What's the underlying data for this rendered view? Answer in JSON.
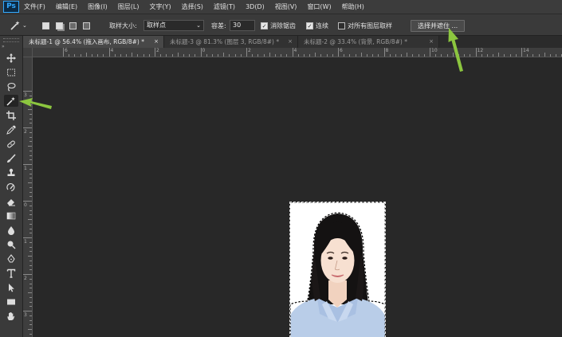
{
  "app": {
    "logo": "Ps"
  },
  "menu": [
    "文件(F)",
    "编辑(E)",
    "图像(I)",
    "图层(L)",
    "文字(Y)",
    "选择(S)",
    "滤镜(T)",
    "3D(D)",
    "视图(V)",
    "窗口(W)",
    "帮助(H)"
  ],
  "options": {
    "sample_size_label": "取样大小:",
    "sample_size_value": "取样点",
    "tolerance_label": "容差:",
    "tolerance_value": "30",
    "antialias_label": "消除锯齿",
    "antialias_checked": true,
    "contiguous_label": "连续",
    "contiguous_checked": true,
    "sample_all_label": "对所有图层取样",
    "sample_all_checked": false,
    "refine_button": "选择并遮住 ..."
  },
  "tabs": [
    {
      "label": "未标题-1 @ 56.4% (拖入画布, RGB/8#) *",
      "close": "×",
      "active": true
    },
    {
      "label": "未标题-3 @ 81.3% (图层 3, RGB/8#) *",
      "close": "×",
      "active": false
    },
    {
      "label": "未标题-2 @ 33.4% (背景, RGB/8#) *",
      "close": "×",
      "active": false
    }
  ],
  "rulers": {
    "horizontal_labels": [
      "6",
      "4",
      "2",
      "0",
      "2",
      "4",
      "6",
      "8",
      "10",
      "12",
      "14"
    ],
    "vertical_labels": [
      "3",
      "2",
      "1",
      "0",
      "1",
      "2",
      "3"
    ]
  },
  "tools": [
    "move-tool",
    "rect-marquee-tool",
    "lasso-tool",
    "magic-wand-tool",
    "crop-tool",
    "eyedropper-tool",
    "healing-brush-tool",
    "brush-tool",
    "clone-stamp-tool",
    "history-brush-tool",
    "eraser-tool",
    "gradient-tool",
    "blur-tool",
    "dodge-tool",
    "pen-tool",
    "type-tool",
    "path-selection-tool",
    "rectangle-tool",
    "hand-tool"
  ],
  "colors": {
    "accent_arrow": "#8cc63f",
    "photo_background": "#34579a"
  }
}
